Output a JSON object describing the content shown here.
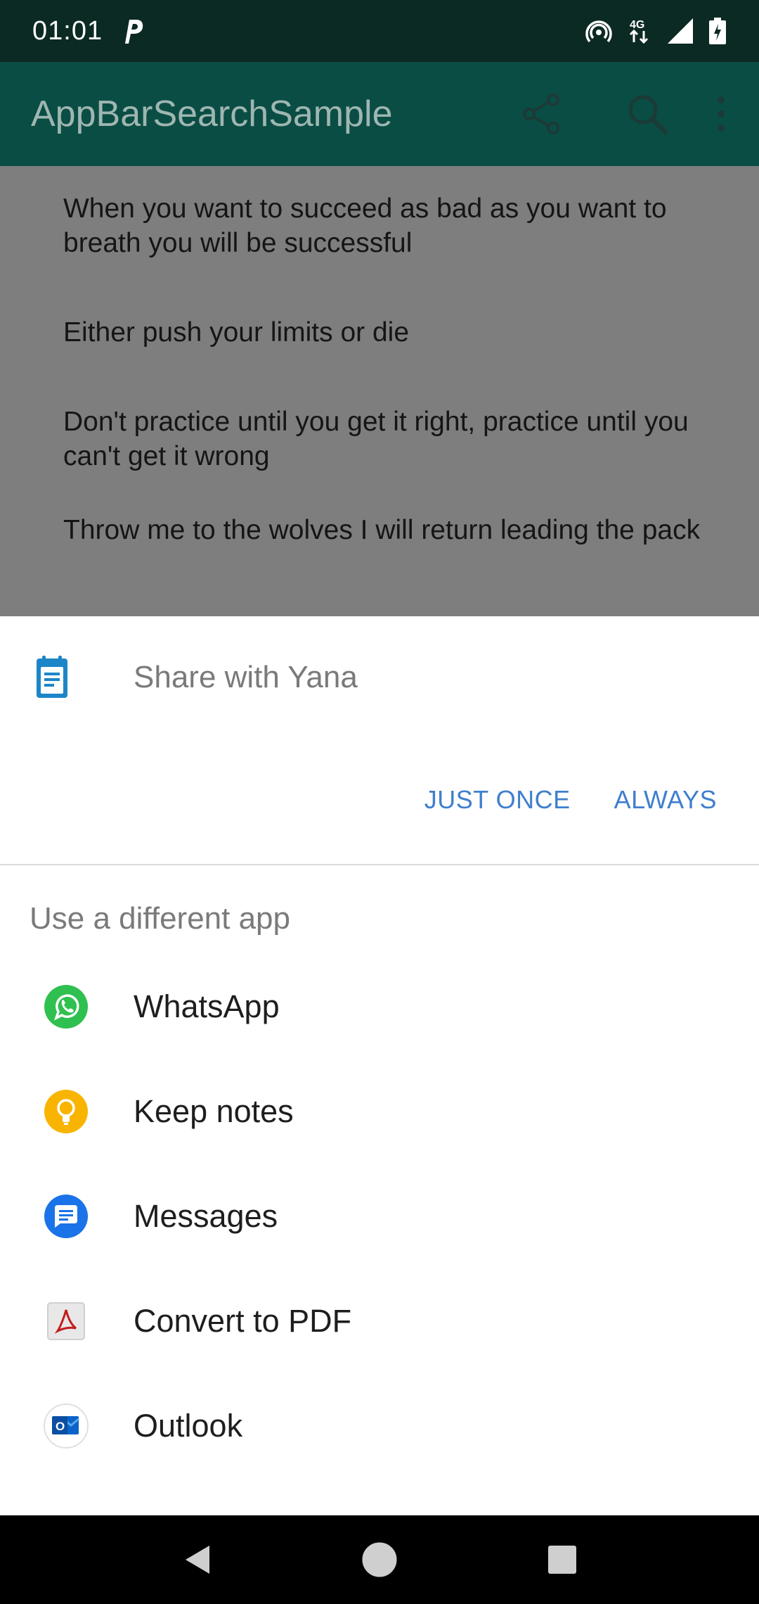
{
  "status_bar": {
    "time": "01:01",
    "network": "4G"
  },
  "app_bar": {
    "title": "AppBarSearchSample",
    "actions": [
      "share-icon",
      "search-icon",
      "more-vert-icon"
    ]
  },
  "quotes": [
    "When you want to succeed as bad as you want to breath you will be successful",
    "Either push your limits or die",
    "Don't practice until you get it right, practice until you can't get it wrong",
    "Throw me to the wolves I will return leading the pack"
  ],
  "share_sheet": {
    "title": "Share with Yana",
    "just_once": "JUST ONCE",
    "always": "ALWAYS",
    "section_label": "Use a different app",
    "apps": [
      {
        "label": "WhatsApp",
        "icon": "whatsapp-icon"
      },
      {
        "label": "Keep notes",
        "icon": "keep-notes-icon"
      },
      {
        "label": "Messages",
        "icon": "messages-icon"
      },
      {
        "label": "Convert to PDF",
        "icon": "pdf-icon"
      },
      {
        "label": "Outlook",
        "icon": "outlook-icon"
      }
    ]
  },
  "colors": {
    "app_bar": "#0a4d44",
    "status_bar": "#0c2a24",
    "accent": "#3f7fce",
    "scrim": "#7e7e7e"
  }
}
